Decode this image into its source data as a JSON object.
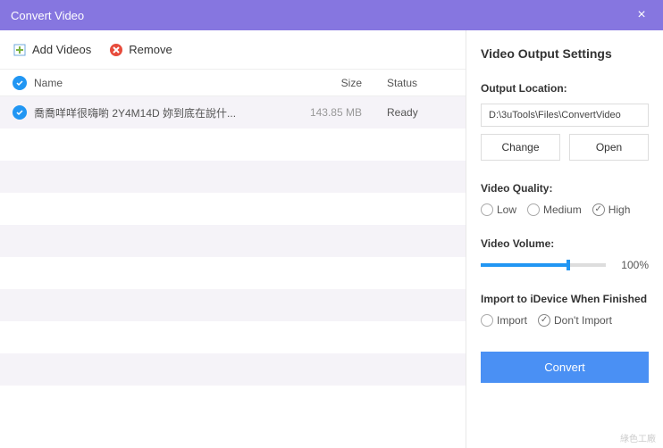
{
  "titlebar": {
    "title": "Convert Video"
  },
  "toolbar": {
    "add": "Add Videos",
    "remove": "Remove"
  },
  "table": {
    "headers": {
      "name": "Name",
      "size": "Size",
      "status": "Status"
    },
    "rows": [
      {
        "name": "喬喬咩咩很嗨喲 2Y4M14D 妳到底在說什...",
        "size": "143.85 MB",
        "status": "Ready"
      }
    ]
  },
  "settings": {
    "title": "Video Output Settings",
    "output_label": "Output Location:",
    "output_path": "D:\\3uTools\\Files\\ConvertVideo",
    "change": "Change",
    "open": "Open",
    "quality_label": "Video Quality:",
    "quality": {
      "low": "Low",
      "medium": "Medium",
      "high": "High"
    },
    "volume_label": "Video Volume:",
    "volume_value": "100%",
    "volume_percent": 70,
    "import_label": "Import to iDevice When Finished",
    "import": {
      "yes": "Import",
      "no": "Don't Import"
    },
    "convert": "Convert"
  },
  "watermark": "綠色工廠"
}
